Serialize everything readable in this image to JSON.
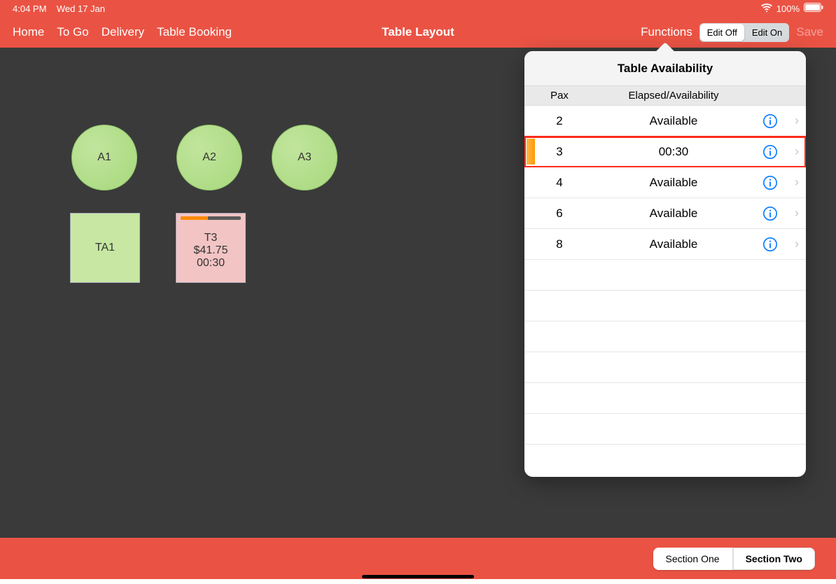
{
  "status": {
    "time": "4:04 PM",
    "date": "Wed 17 Jan",
    "battery": "100%"
  },
  "nav": {
    "items": {
      "home": "Home",
      "togo": "To Go",
      "delivery": "Delivery",
      "booking": "Table Booking"
    },
    "title": "Table Layout",
    "functions": "Functions",
    "edit_off": "Edit Off",
    "edit_on": "Edit On",
    "save": "Save"
  },
  "tables": {
    "circles": [
      "A1",
      "A2",
      "A3"
    ],
    "square_a": "TA1",
    "square_b": {
      "name": "T3",
      "amount": "$41.75",
      "elapsed": "00:30"
    }
  },
  "popover": {
    "title": "Table Availability",
    "col_pax": "Pax",
    "col_elapsed": "Elapsed/Availability",
    "rows": [
      {
        "pax": "2",
        "val": "Available",
        "highlight": false
      },
      {
        "pax": "3",
        "val": "00:30",
        "highlight": true
      },
      {
        "pax": "4",
        "val": "Available",
        "highlight": false
      },
      {
        "pax": "6",
        "val": "Available",
        "highlight": false
      },
      {
        "pax": "8",
        "val": "Available",
        "highlight": false
      }
    ]
  },
  "bottom": {
    "section_one": "Section One",
    "section_two": "Section Two"
  }
}
